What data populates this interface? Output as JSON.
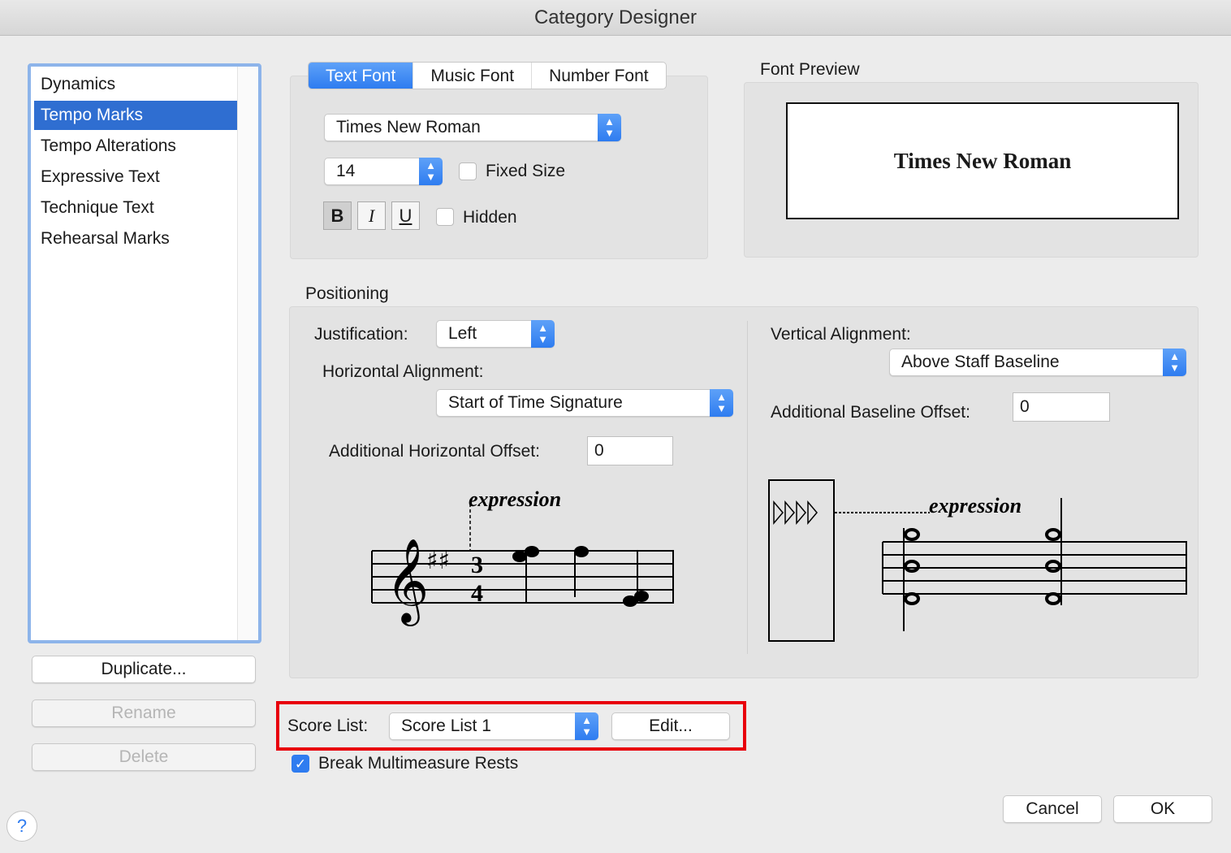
{
  "window": {
    "title": "Category Designer"
  },
  "categories": {
    "items": [
      "Dynamics",
      "Tempo Marks",
      "Tempo Alterations",
      "Expressive Text",
      "Technique Text",
      "Rehearsal Marks"
    ],
    "selected": "Tempo Marks"
  },
  "left_buttons": {
    "duplicate": "Duplicate...",
    "rename": "Rename",
    "delete": "Delete"
  },
  "font": {
    "tabs": [
      "Text Font",
      "Music Font",
      "Number Font"
    ],
    "active_tab": "Text Font",
    "family": "Times New Roman",
    "size": "14",
    "fixed_size_label": "Fixed Size",
    "fixed_size": false,
    "bold": "B",
    "italic": "I",
    "underline": "U",
    "bold_on": true,
    "hidden_label": "Hidden",
    "hidden": false
  },
  "preview": {
    "label": "Font Preview",
    "text": "Times New Roman"
  },
  "positioning": {
    "label": "Positioning",
    "justification_label": "Justification:",
    "justification": "Left",
    "horizontal_alignment_label": "Horizontal Alignment:",
    "horizontal_alignment": "Start of Time Signature",
    "h_offset_label": "Additional Horizontal Offset:",
    "h_offset": "0",
    "vertical_alignment_label": "Vertical Alignment:",
    "vertical_alignment": "Above Staff Baseline",
    "baseline_offset_label": "Additional Baseline Offset:",
    "baseline_offset": "0",
    "example_text": "expression"
  },
  "score_list": {
    "label": "Score List:",
    "value": "Score List 1",
    "edit": "Edit...",
    "highlight_color": "#e8000b"
  },
  "break_mm_rests": {
    "label": "Break Multimeasure Rests",
    "checked": true
  },
  "footer": {
    "help": "?",
    "cancel": "Cancel",
    "ok": "OK"
  },
  "colors": {
    "accent": "#2f7cf0",
    "selection": "#2f6ed1"
  }
}
